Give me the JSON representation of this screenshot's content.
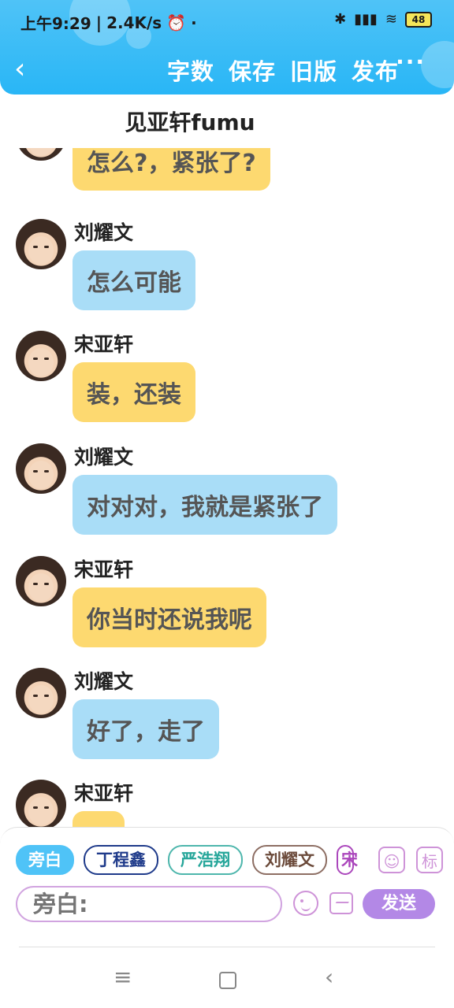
{
  "status_bar": {
    "time": "上午9:29",
    "speed": "2.4K/s",
    "battery": "48"
  },
  "header": {
    "actions": [
      "字数",
      "保存",
      "旧版",
      "发布"
    ],
    "more": "···"
  },
  "chat_title": "见亚轩fumu",
  "messages": [
    {
      "name": "",
      "text": "怎么?，紧张了?",
      "color": "yellow"
    },
    {
      "name": "刘耀文",
      "text": "怎么可能",
      "color": "blue"
    },
    {
      "name": "宋亚轩",
      "text": "装，还装",
      "color": "yellow"
    },
    {
      "name": "刘耀文",
      "text": "对对对，我就是紧张了",
      "color": "blue"
    },
    {
      "name": "宋亚轩",
      "text": "你当时还说我呢",
      "color": "yellow"
    },
    {
      "name": "刘耀文",
      "text": "好了，走了",
      "color": "blue"
    },
    {
      "name": "宋亚轩",
      "text": "",
      "color": "yellow"
    }
  ],
  "input": {
    "chips": [
      "旁白",
      "丁程鑫",
      "严浩翔",
      "刘耀文",
      "宋"
    ],
    "placeholder": "旁白:",
    "send_label": "发送",
    "side_icon_label": "标"
  },
  "colors": {
    "header": "#29b6f6",
    "yellow_bubble": "#fdd970",
    "blue_bubble": "#a9ddf7",
    "send_button": "#b388e6"
  }
}
